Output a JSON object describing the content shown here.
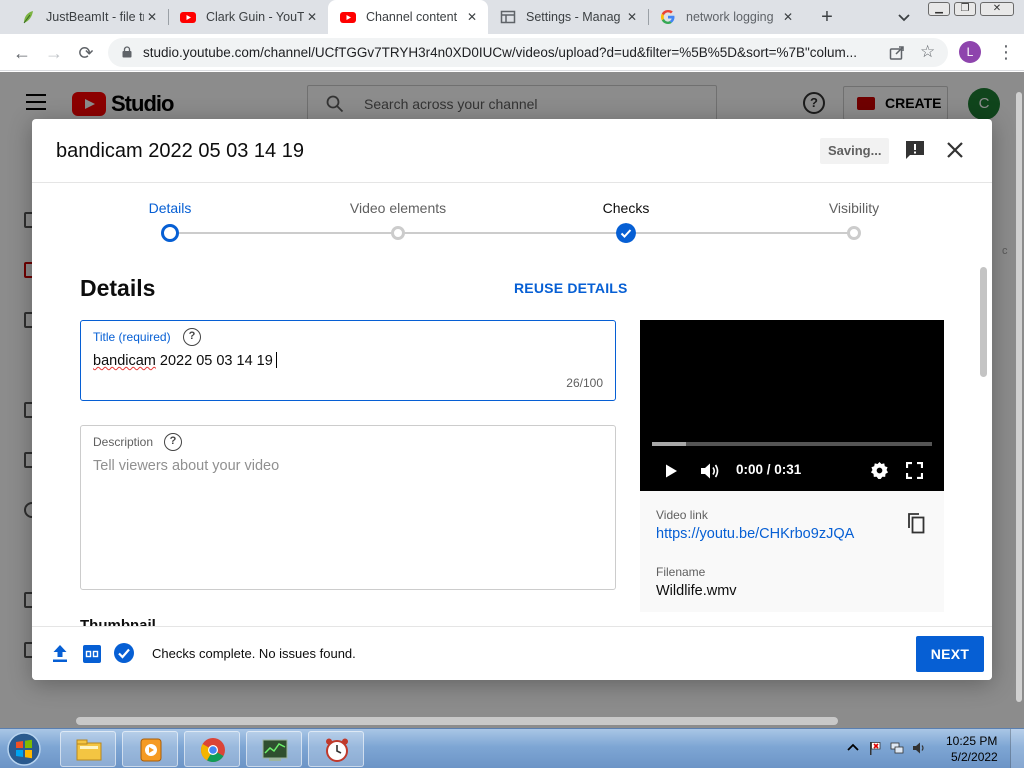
{
  "browser": {
    "tabs": [
      {
        "label": "JustBeamIt - file tr",
        "favicon": "justbeamit-leaf-icon",
        "active": false
      },
      {
        "label": "Clark Guin - YouTu",
        "favicon": "youtube-icon",
        "active": false
      },
      {
        "label": "Channel content",
        "favicon": "youtube-icon",
        "active": true
      },
      {
        "label": "Settings - Manag",
        "favicon": "settings-page-icon",
        "active": false
      },
      {
        "label": "network logging",
        "favicon": "google-icon",
        "active": false
      }
    ],
    "address": "studio.youtube.com/channel/UCfTGGv7TRYH3r4n0XD0IUCw/videos/upload?d=ud&filter=%5B%5D&sort=%7B\"colum...",
    "profile_initial": "L"
  },
  "studio": {
    "logo_text": "Studio",
    "search_placeholder": "Search across your channel",
    "create_label": "CREATE",
    "avatar_initial": "C"
  },
  "dialog": {
    "title": "bandicam 2022 05 03 14 19",
    "saving_label": "Saving...",
    "steps": [
      {
        "label": "Details",
        "state": "current"
      },
      {
        "label": "Video elements",
        "state": "pending"
      },
      {
        "label": "Checks",
        "state": "done"
      },
      {
        "label": "Visibility",
        "state": "pending"
      }
    ],
    "section_heading": "Details",
    "reuse_label": "REUSE DETAILS",
    "title_field": {
      "label": "Title (required)",
      "value_word1": "bandicam",
      "value_rest": " 2022 05 03 14 19",
      "counter": "26/100"
    },
    "description_field": {
      "label": "Description",
      "placeholder": "Tell viewers about your video"
    },
    "thumbnail_heading": "Thumbnail",
    "video": {
      "time": "0:00 / 0:31",
      "buffered_fraction": 0.12,
      "link_label": "Video link",
      "link": "https://youtu.be/CHKrbo9zJQA",
      "filename_label": "Filename",
      "filename": "Wildlife.wmv"
    },
    "footer": {
      "status": "Checks complete. No issues found.",
      "next_label": "NEXT"
    }
  },
  "taskbar": {
    "time": "10:25 PM",
    "date": "5/2/2022",
    "pinned": [
      "windows-explorer-icon",
      "media-player-icon",
      "chrome-icon",
      "task-manager-icon",
      "clock-app-icon"
    ]
  },
  "colors": {
    "accent_blue": "#065fd4",
    "youtube_red": "#ff0000",
    "tab_strip": "#dee1e6"
  }
}
